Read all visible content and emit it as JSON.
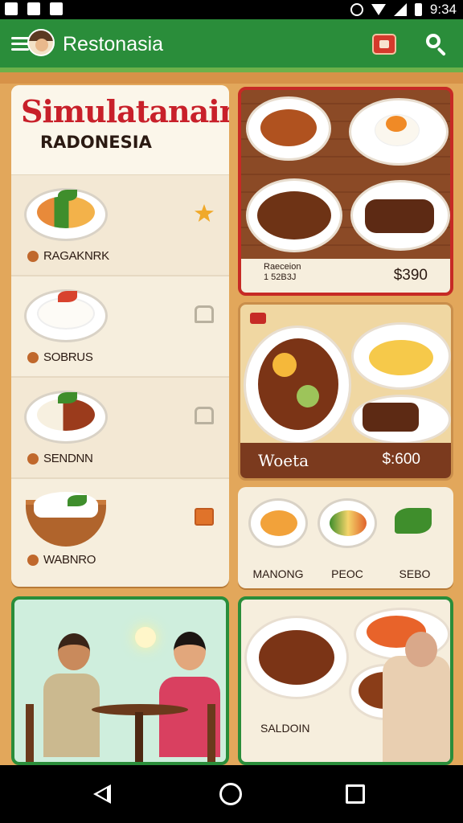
{
  "status_bar": {
    "time": "9:34"
  },
  "app_bar": {
    "title": "Restonasia"
  },
  "menu": {
    "title": "Simulatanain",
    "subtitle": "RADONESIA",
    "items": [
      {
        "name": "RAGAKNRK",
        "action_icon": "star-icon"
      },
      {
        "name": "SOBRUS",
        "action_icon": "bookmark-icon"
      },
      {
        "name": "SENDNN",
        "action_icon": "bookmark-icon"
      },
      {
        "name": "WABNRO",
        "action_icon": "box-icon"
      }
    ]
  },
  "featured_top": {
    "label_line1": "Raeceion",
    "label_line2": "1 52B3J",
    "price": "$390"
  },
  "featured_mid": {
    "name": "Woeta",
    "price": "$:600"
  },
  "categories": [
    {
      "label": "MANONG"
    },
    {
      "label": "PEOC"
    },
    {
      "label": "SEBO"
    }
  ],
  "banner_right": {
    "label": "SALDOIN"
  },
  "colors": {
    "brand_green": "#2a8d3a",
    "accent_red": "#c8202a",
    "background": "#e2a75b",
    "dark_brown": "#7b3a1e"
  }
}
